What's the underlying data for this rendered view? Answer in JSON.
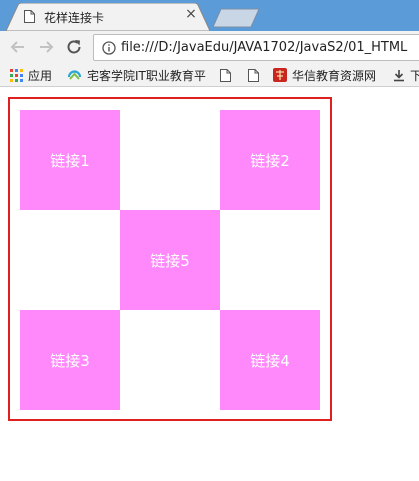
{
  "browser": {
    "tab": {
      "title": "花样连接卡",
      "close_glyph": "×",
      "icon": "document-icon"
    },
    "toolbar": {
      "url": "file:///D:/JavaEdu/JAVA1702/JavaS2/01_HTML"
    },
    "bookmarks": [
      {
        "label": "应用",
        "icon": "apps-grid-icon"
      },
      {
        "label": "宅客学院IT职业教育平",
        "icon": "circle-logo-icon"
      },
      {
        "label": "",
        "icon": "document-icon"
      },
      {
        "label": "",
        "icon": "document-icon"
      },
      {
        "label": "华信教育资源网",
        "icon": "red-logo-icon"
      },
      {
        "label": "下",
        "icon": "download-icon"
      }
    ]
  },
  "page": {
    "links": [
      {
        "label": "链接1"
      },
      {
        "label": "链接2"
      },
      {
        "label": "链接5"
      },
      {
        "label": "链接3"
      },
      {
        "label": "链接4"
      }
    ],
    "colors": {
      "cell": "#ff88fb",
      "border": "#e01f1f",
      "text": "#ffffff"
    }
  }
}
